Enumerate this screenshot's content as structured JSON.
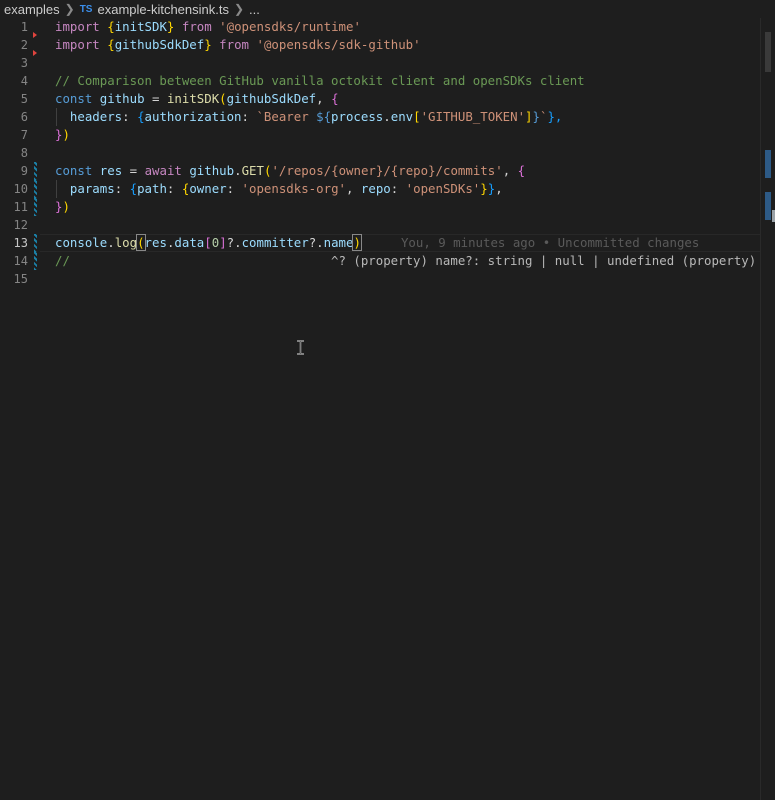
{
  "breadcrumb": {
    "folder": "examples",
    "file_badge": "TS",
    "file": "example-kitchensink.ts",
    "more": "..."
  },
  "line_numbers": [
    "1",
    "2",
    "3",
    "4",
    "5",
    "6",
    "7",
    "8",
    "9",
    "10",
    "11",
    "12",
    "13",
    "14",
    "15"
  ],
  "active_line": "13",
  "code": {
    "l1": [
      "import",
      " ",
      "{",
      "initSDK",
      "}",
      " ",
      "from",
      " ",
      "'@opensdks/runtime'"
    ],
    "l2": [
      "import",
      " ",
      "{",
      "githubSdkDef",
      "}",
      " ",
      "from",
      " ",
      "'@opensdks/sdk-github'"
    ],
    "l4": "// Comparison between GitHub vanilla octokit client and openSDKs client",
    "l5": [
      "const",
      " ",
      "github",
      " = ",
      "initSDK",
      "(",
      "githubSdkDef",
      ", ",
      "{"
    ],
    "l6": [
      "  ",
      "headers",
      ": ",
      "{",
      "authorization",
      ": ",
      "`Bearer ",
      "${",
      "process",
      ".",
      "env",
      "[",
      "'GITHUB_TOKEN'",
      "]",
      "}",
      "`",
      "},"
    ],
    "l7": [
      "}",
      ")"
    ],
    "l9": [
      "const",
      " ",
      "res",
      " = ",
      "await",
      " ",
      "github",
      ".",
      "GET",
      "(",
      "'/repos/{owner}/{repo}/commits'",
      ", ",
      "{"
    ],
    "l10": [
      "  ",
      "params",
      ": ",
      "{",
      "path",
      ": ",
      "{",
      "owner",
      ": ",
      "'opensdks-org'",
      ", ",
      "repo",
      ": ",
      "'openSDKs'",
      "}",
      "}",
      ","
    ],
    "l11": [
      "}",
      ")"
    ],
    "l13": [
      "console",
      ".",
      "log",
      "(",
      "res",
      ".",
      "data",
      "[",
      "0",
      "]",
      "?.",
      "committer",
      "?.",
      "name",
      ")"
    ],
    "l13_blame": "You, 9 minutes ago • Uncommitted changes",
    "l14_comment": "//",
    "l14_hint": "^? (property) name?: string | null | undefined (property) na"
  },
  "colors": {
    "background": "#1e1e1e",
    "keyword": "#c586c0",
    "string": "#ce9178",
    "comment": "#6a9955",
    "variable": "#9cdcfe",
    "function": "#dcdcaa"
  }
}
